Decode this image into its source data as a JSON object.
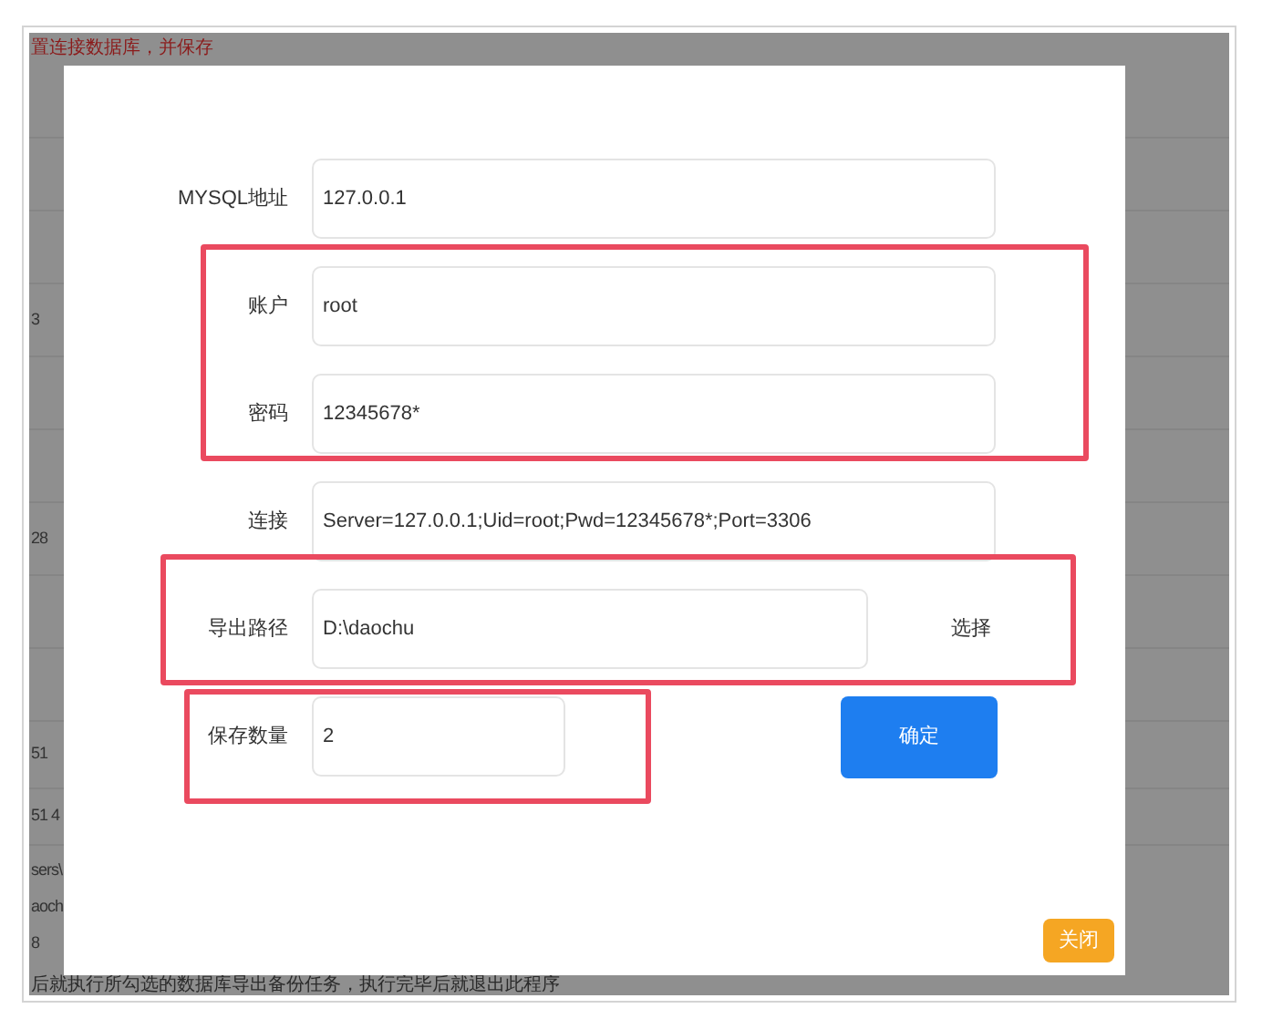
{
  "background": {
    "notice": "置连接数据库，并保存",
    "table_cells": [
      "3",
      "28",
      "51",
      "51 4"
    ],
    "path_lines": [
      "sers\\",
      "aoch",
      "8"
    ],
    "footer_note": "后就执行所勾选的数据库导出备份任务，执行完毕后就退出此程序"
  },
  "dialog": {
    "groups": [
      {
        "highlighted": false,
        "rows": [
          {
            "kind": "field",
            "label": "MYSQL地址",
            "value": "127.0.0.1"
          }
        ]
      },
      {
        "highlighted": true,
        "rows": [
          {
            "kind": "field",
            "label": "账户",
            "value": "root"
          },
          {
            "kind": "field",
            "label": "密码",
            "value": "12345678*"
          }
        ]
      },
      {
        "highlighted": false,
        "rows": [
          {
            "kind": "field",
            "label": "连接",
            "value": "Server=127.0.0.1;Uid=root;Pwd=12345678*;Port=3306"
          }
        ]
      },
      {
        "highlighted": true,
        "rows": [
          {
            "kind": "path",
            "label": "导出路径",
            "value": "D:\\daochu",
            "button": "选择"
          }
        ]
      },
      {
        "highlighted": true,
        "rows": [
          {
            "kind": "count",
            "label": "保存数量",
            "value": "2",
            "button": "确定"
          }
        ]
      }
    ],
    "close_button": "关闭"
  }
}
